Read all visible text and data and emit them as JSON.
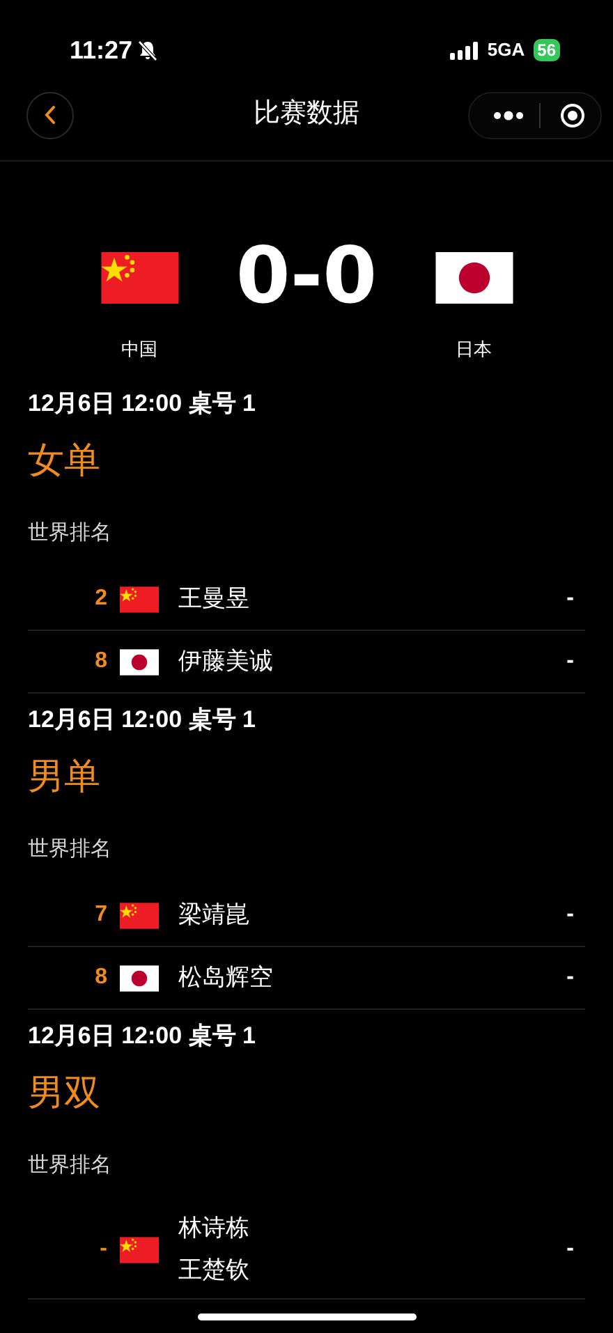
{
  "status_bar": {
    "time": "11:27",
    "network": "5GA",
    "battery": "56"
  },
  "nav": {
    "title": "比赛数据"
  },
  "scoreboard": {
    "home": {
      "name": "中国",
      "kind": "china"
    },
    "away": {
      "name": "日本",
      "kind": "japan"
    },
    "score": "0-0"
  },
  "matches": [
    {
      "header": "12月6日 12:00 桌号 1",
      "event": "女单",
      "ranking_label": "世界排名",
      "rows": [
        {
          "rank": "2",
          "kind": "china",
          "players": [
            "王曼昱"
          ],
          "score": "-"
        },
        {
          "rank": "8",
          "kind": "japan",
          "players": [
            "伊藤美诚"
          ],
          "score": "-"
        }
      ]
    },
    {
      "header": "12月6日 12:00 桌号 1",
      "event": "男单",
      "ranking_label": "世界排名",
      "rows": [
        {
          "rank": "7",
          "kind": "china",
          "players": [
            "梁靖崑"
          ],
          "score": "-"
        },
        {
          "rank": "8",
          "kind": "japan",
          "players": [
            "松岛辉空"
          ],
          "score": "-"
        }
      ]
    },
    {
      "header": "12月6日 12:00 桌号 1",
      "event": "男双",
      "ranking_label": "世界排名",
      "rows": [
        {
          "rank": "-",
          "kind": "china",
          "players": [
            "林诗栋",
            "王楚钦"
          ],
          "score": "-"
        }
      ]
    }
  ]
}
